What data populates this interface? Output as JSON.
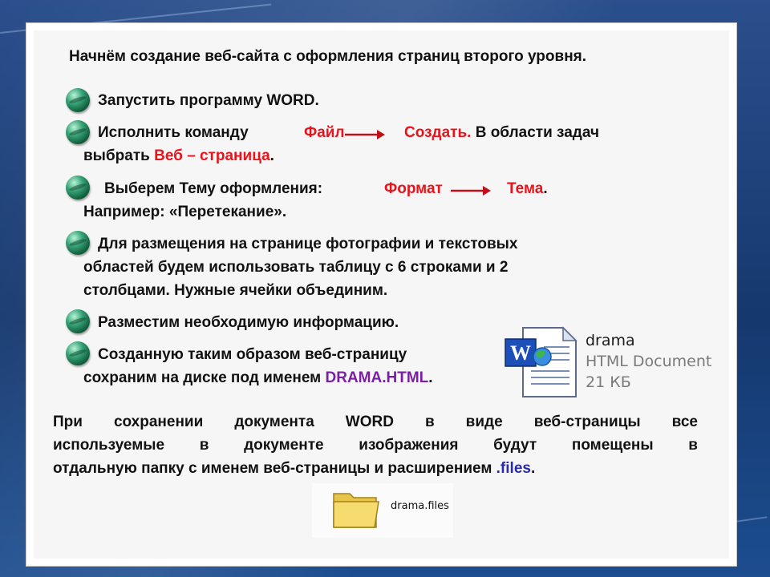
{
  "heading": "Начнём создание веб-сайта с оформления страниц второго уровня.",
  "steps": [
    {
      "text": "Запустить программу WORD."
    },
    {
      "pre": "Исполнить команду",
      "menu1": "Файл",
      "menu2": "Создать.",
      "post": " В области задач",
      "line2_pre": "выбрать ",
      "line2_red": "Веб – страница",
      "line2_post": "."
    },
    {
      "pre": "Выберем Тему оформления: ",
      "menu1": "Формат",
      "menu2": "Тема",
      "post": ".",
      "line2": "Например: «Перетекание»."
    },
    {
      "line1": "Для размещения на странице фотографии и текстовых",
      "line2": "областей будем использовать таблицу с 6 строками и 2",
      "line3": "столбцами. Нужные ячейки объединим."
    },
    {
      "text": "Разместим необходимую информацию."
    },
    {
      "line1": "Созданную таким образом веб-страницу",
      "line2_pre": "сохраним на диске под именем ",
      "line2_purple": "DRAMA.HTML",
      "line2_post": "."
    }
  ],
  "file_preview": {
    "name": "drama",
    "type": "HTML Document",
    "size": "21 КБ",
    "icon_letter": "W"
  },
  "paragraph": {
    "line1": [
      "При",
      "сохранении",
      "документа",
      "WORD",
      "в",
      "виде",
      "веб-страницы",
      "все"
    ],
    "line2": [
      "используемые",
      "в",
      "документе",
      "изображения",
      "будут",
      "помещены",
      "в"
    ],
    "line3_pre": "отдальную папку с именем веб-страницы и расширением ",
    "line3_ext": ".files",
    "line3_post": "."
  },
  "folder": {
    "label": "drama.files"
  },
  "colors": {
    "accent_red": "#e8131b",
    "accent_purple": "#7a1fa2",
    "files_blue": "#2a2aa8",
    "bullet_green": "#1e8a5a",
    "background_blue": "#1b3f78"
  }
}
